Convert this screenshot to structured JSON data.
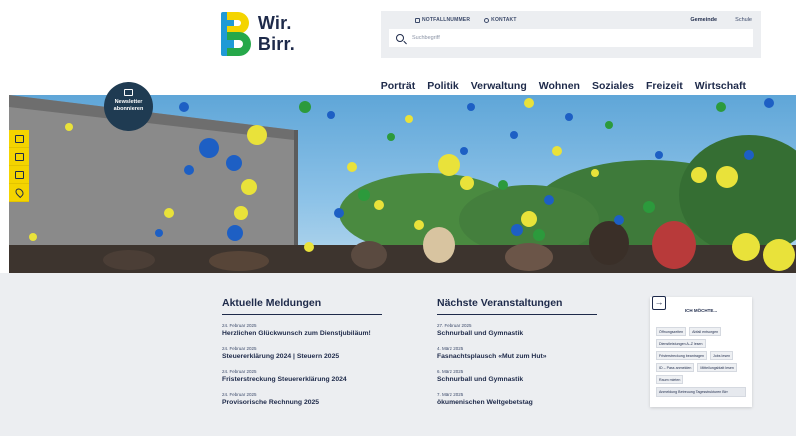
{
  "site": {
    "logo_text": "Wir. Birr."
  },
  "topbar": {
    "links": [
      "NOTFALLNUMMER",
      "KONTAKT"
    ],
    "gemeinde": "Gemeinde",
    "schule": "Schule",
    "search_placeholder": "Suchbegriff"
  },
  "nav": [
    "Porträt",
    "Politik",
    "Verwaltung",
    "Wohnen",
    "Soziales",
    "Freizeit",
    "Wirtschaft"
  ],
  "newsletter": {
    "line1": "Newsletter",
    "line2": "abonnieren"
  },
  "sidetools": [
    "map-icon",
    "bus-icon",
    "people-icon",
    "location-pin-icon"
  ],
  "news": {
    "title": "Aktuelle Meldungen",
    "items": [
      {
        "date": "24. Februar 2025",
        "title": "Herzlichen Glückwunsch zum Dienstjubiläum!"
      },
      {
        "date": "24. Februar 2025",
        "title": "Steuererklärung 2024 | Steuern 2025"
      },
      {
        "date": "24. Februar 2025",
        "title": "Fristerstreckung Steuererklärung 2024"
      },
      {
        "date": "24. Februar 2025",
        "title": "Provisorische Rechnung 2025"
      }
    ]
  },
  "events": {
    "title": "Nächste Veranstaltungen",
    "items": [
      {
        "date": "27. Februar 2025",
        "title": "Schnurball und Gymnastik"
      },
      {
        "date": "4. März 2025",
        "title": "Fasnachtsplausch «Mut zum Hut»"
      },
      {
        "date": "6. März 2025",
        "title": "Schnurball und Gymnastik"
      },
      {
        "date": "7. März 2025",
        "title": "ökumenischen Weltgebetstag"
      }
    ]
  },
  "quick": {
    "title": "ICH MÖCHTE...",
    "chips": [
      "Öffnungszeiten",
      "Abfall entsorgen",
      "Dienstleistungen A–Z lesen",
      "Fristerstreckung beantragen",
      "Jobs lesen",
      "ID – Pass anmelden",
      "Mitteilungsblatt lesen",
      "Raum mieten"
    ],
    "wide_chip": "Anmeldung Betreuung Tagesstrukturen Birr"
  },
  "colors": {
    "navy": "#1e2a4a",
    "yellow": "#f4d400",
    "blue": "#1f9ad6",
    "green": "#26a84a"
  }
}
